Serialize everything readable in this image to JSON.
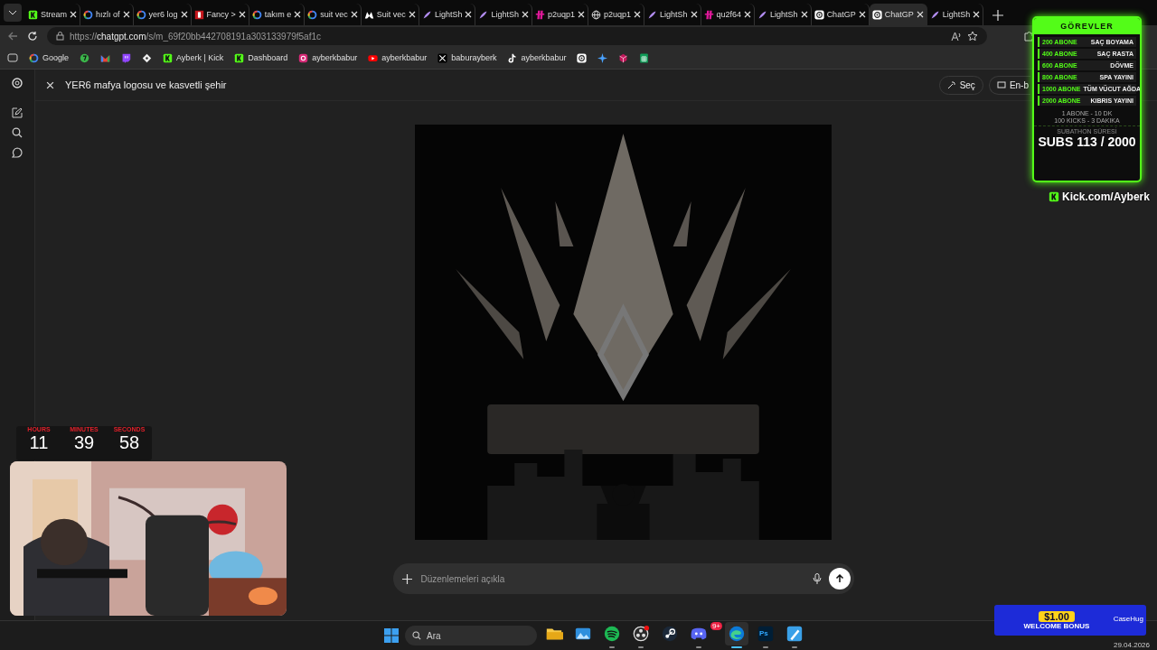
{
  "browser": {
    "tabs": [
      {
        "label": "Stream",
        "kind": "kick",
        "selected": false
      },
      {
        "label": "hızlı of",
        "kind": "google",
        "selected": false
      },
      {
        "label": "yer6 log",
        "kind": "google",
        "selected": false
      },
      {
        "label": "Fancy >",
        "kind": "fancy",
        "selected": false
      },
      {
        "label": "takım e",
        "kind": "google",
        "selected": false
      },
      {
        "label": "suit vec",
        "kind": "google",
        "selected": false
      },
      {
        "label": "Suit vec",
        "kind": "mark",
        "selected": false
      },
      {
        "label": "LightSh",
        "kind": "feather",
        "selected": false
      },
      {
        "label": "LightSh",
        "kind": "feather",
        "selected": false
      },
      {
        "label": "p2uqp1",
        "kind": "hash",
        "selected": false
      },
      {
        "label": "p2uqp1",
        "kind": "globe",
        "selected": false
      },
      {
        "label": "LightSh",
        "kind": "feather",
        "selected": false
      },
      {
        "label": "qu2f64",
        "kind": "hash",
        "selected": false
      },
      {
        "label": "LightSh",
        "kind": "feather",
        "selected": false
      },
      {
        "label": "ChatGP",
        "kind": "openai",
        "selected": false
      },
      {
        "label": "ChatGP",
        "kind": "openai",
        "selected": true
      },
      {
        "label": "LightSh",
        "kind": "feather",
        "selected": false
      }
    ],
    "address": {
      "scheme": "https://",
      "host": "chatgpt.com",
      "path": "/s/m_69f20bb442708191a303133979f5af1c"
    },
    "bookmarks": [
      {
        "label": "Google",
        "kind": "google"
      },
      {
        "kind": "green"
      },
      {
        "kind": "gmail"
      },
      {
        "kind": "twitch"
      },
      {
        "kind": "diamond"
      },
      {
        "label": "Ayberk | Kick",
        "kind": "kick"
      },
      {
        "label": "Dashboard",
        "kind": "kick"
      },
      {
        "label": "ayberkbabur",
        "kind": "instagram"
      },
      {
        "label": "ayberkbabur",
        "kind": "youtube"
      },
      {
        "label": "baburayberk",
        "kind": "x"
      },
      {
        "label": "ayberkbabur",
        "kind": "tiktok"
      },
      {
        "kind": "openai"
      },
      {
        "kind": "spark"
      },
      {
        "kind": "cube"
      },
      {
        "kind": "sheet"
      }
    ]
  },
  "chat": {
    "title": "YER6 mafya logosu ve kasvetli şehir",
    "actions": [
      "Seç",
      "En-b"
    ],
    "image": {
      "kind": "picture"
    },
    "composer": {
      "placeholder": "Düzenlemeleri açıkla"
    }
  },
  "overlay": {
    "tasks": {
      "title": "GÖREVLER",
      "rows": [
        {
          "goal": "200 ABONE",
          "reward": "SAÇ BOYAMA"
        },
        {
          "goal": "400 ABONE",
          "reward": "SAÇ RASTA"
        },
        {
          "goal": "600 ABONE",
          "reward": "DÖVME"
        },
        {
          "goal": "800 ABONE",
          "reward": "SPA YAYINI"
        },
        {
          "goal": "1000 ABONE",
          "reward": "TÜM VÜCUT AĞDA"
        },
        {
          "goal": "2000 ABONE",
          "reward": "KIBRIS YAYINI"
        }
      ],
      "footer": [
        "1 ABONE - 10 DK",
        "100 KICKS - 3 DAKIKA"
      ],
      "counter_label": "SUBATHON SÜRESİ",
      "counter": "SUBS 113 / 2000"
    },
    "kick_link": "Kick.com/Ayberk",
    "timer": [
      {
        "label": "HOURS",
        "value": "11"
      },
      {
        "label": "MINUTES",
        "value": "39"
      },
      {
        "label": "SECONDS",
        "value": "58"
      }
    ],
    "webcam": {
      "kind": "picture"
    },
    "ad": {
      "amount": "$1.00",
      "caption": "WELCOME BONUS",
      "brand": "CaseHug"
    }
  },
  "taskbar": {
    "search": "Ara",
    "apps": [
      {
        "kind": "folder",
        "selected": false,
        "running": false
      },
      {
        "kind": "photos",
        "selected": false,
        "running": false
      },
      {
        "kind": "spotify",
        "selected": false,
        "running": true
      },
      {
        "kind": "obs",
        "selected": false,
        "running": true
      },
      {
        "kind": "steam",
        "selected": false,
        "running": false
      },
      {
        "kind": "discord",
        "badge": "9+",
        "selected": false,
        "running": true
      },
      {
        "kind": "edge",
        "selected": true,
        "running": true
      },
      {
        "kind": "ps",
        "label": "Ps",
        "selected": false,
        "running": true
      },
      {
        "kind": "paint",
        "selected": false,
        "running": true
      }
    ],
    "date": "29.04.2026"
  }
}
